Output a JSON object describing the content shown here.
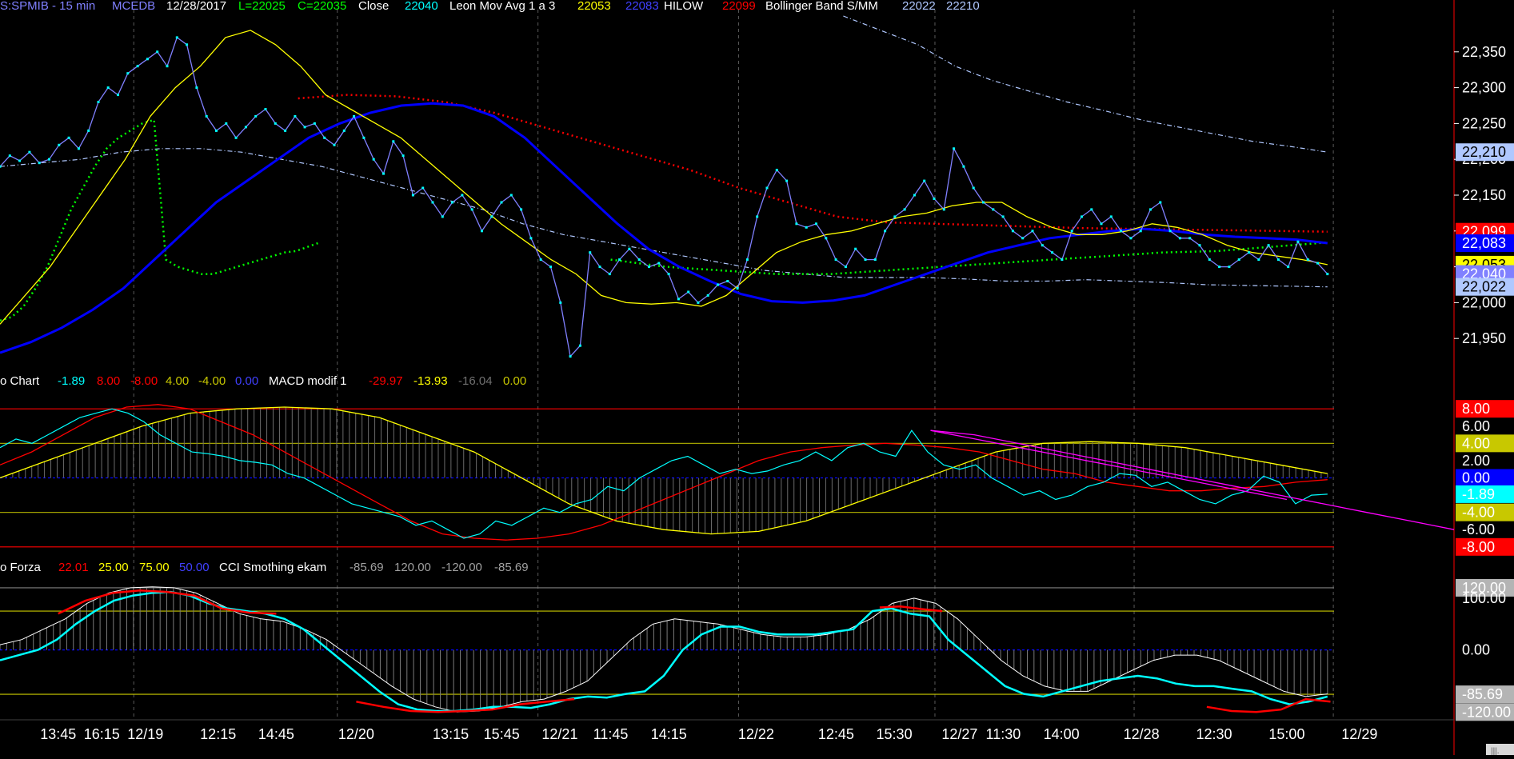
{
  "colors": {
    "background": "#000000",
    "axis_divider": "#ff0000",
    "price_close": "#8080ff",
    "price_points": "#00ffff",
    "leon_avg": "#ffff00",
    "hilow_blue": "#0000ff",
    "hilow_red": "#ff0000",
    "bollinger": "#b0c8ff",
    "green_dots": "#00ff00",
    "macd_cyan": "#00ffff",
    "macd_red": "#ff0000",
    "macd_yellow": "#ffff00",
    "magenta_trend": "#ff00ff",
    "cci_cyan": "#00ffff",
    "cci_red": "#ff0000",
    "cci_white": "#ffffff"
  },
  "header_price": {
    "symbol": "S:SPMIB - 15 min",
    "source": "MCEDB",
    "date": "12/28/2017",
    "low": "L=22025",
    "close_eq": "C=22035",
    "close_label": "Close",
    "close_value": "22040",
    "leon_label": "Leon Mov Avg 1 a 3",
    "leon_value": "22053",
    "hilow_blue_value": "22083",
    "hilow_label": "HILOW",
    "hilow_red_value": "22099",
    "bollinger_label": "Bollinger Band S/MM",
    "bollinger_low": "22022",
    "bollinger_high": "22210"
  },
  "header_macd": {
    "chart_label": "o Chart",
    "v1": "-1.89",
    "v2": "8.00",
    "v3": "-8.00",
    "v4": "4.00",
    "v5": "-4.00",
    "v6": "0.00",
    "macd_label": "MACD modif 1",
    "v7": "-29.97",
    "v8": "-13.93",
    "v9": "-16.04",
    "v10": "0.00"
  },
  "header_cci": {
    "forza_label": "o Forza",
    "v1": "22.01",
    "v2": "25.00",
    "v3": "75.00",
    "v4": "50.00",
    "cci_label": "CCI Smothing ekam",
    "v5": "-85.69",
    "v6": "120.00",
    "v7": "-120.00",
    "v8": "-85.69"
  },
  "axis_price": [
    "22,350",
    "22,300",
    "22,250",
    "22,200",
    "22,150",
    "22,100",
    "22,050",
    "22,000",
    "21,950"
  ],
  "axis_price_values": [
    22350,
    22300,
    22250,
    22200,
    22150,
    22100,
    22050,
    22000,
    21950
  ],
  "badges_price": [
    {
      "text": "22,210",
      "value": 22210,
      "bg": "#b0c8ff",
      "fg": "#000000"
    },
    {
      "text": "22,099",
      "value": 22099,
      "bg": "#ff0000",
      "fg": "#ffffff"
    },
    {
      "text": "22,083",
      "value": 22083,
      "bg": "#0000ff",
      "fg": "#ffffff"
    },
    {
      "text": "22,053",
      "value": 22053,
      "bg": "#ffff00",
      "fg": "#000000"
    },
    {
      "text": "22,040",
      "value": 22040,
      "bg": "#8080ff",
      "fg": "#ffffff"
    },
    {
      "text": "22,022",
      "value": 22022,
      "bg": "#b0c8ff",
      "fg": "#000000"
    }
  ],
  "axis_macd": [
    {
      "text": "8.00",
      "value": 8,
      "badge": "#ff0000",
      "fg": "#ffffff"
    },
    {
      "text": "6.00",
      "value": 6,
      "badge": "",
      "fg": "#ffffff"
    },
    {
      "text": "4.00",
      "value": 4,
      "badge": "#c8c800",
      "fg": "#000000"
    },
    {
      "text": "2.00",
      "value": 2,
      "badge": "",
      "fg": "#ffffff"
    },
    {
      "text": "0.00",
      "value": 0,
      "badge": "#0000ff",
      "fg": "#ffffff"
    },
    {
      "text": "-1.89",
      "value": -1.89,
      "badge": "#00ffff",
      "fg": "#000000"
    },
    {
      "text": "-4.00",
      "value": -4,
      "badge": "#c8c800",
      "fg": "#000000"
    },
    {
      "text": "-6.00",
      "value": -6,
      "badge": "",
      "fg": "#ffffff"
    },
    {
      "text": "-8.00",
      "value": -8,
      "badge": "#ff0000",
      "fg": "#ffffff"
    }
  ],
  "axis_cci": [
    {
      "text": "120.00",
      "value": 120,
      "badge": "#b4b4b4",
      "fg": "#000000"
    },
    {
      "text": "100.00",
      "value": 100,
      "badge": "",
      "fg": "#ffffff"
    },
    {
      "text": "0.00",
      "value": 0,
      "badge": "",
      "fg": "#ffffff"
    },
    {
      "text": "-85.69",
      "value": -85.69,
      "badge": "#b4b4b4",
      "fg": "#000000"
    },
    {
      "text": "-120.00",
      "value": -120,
      "badge": "#b4b4b4",
      "fg": "#000000"
    }
  ],
  "time_labels": [
    {
      "text": "13:45",
      "slot": 0.04
    },
    {
      "text": "16:15",
      "slot": 0.07
    },
    {
      "text": "12/19",
      "slot": 0.1
    },
    {
      "text": "12:15",
      "slot": 0.15
    },
    {
      "text": "14:45",
      "slot": 0.19
    },
    {
      "text": "12/20",
      "slot": 0.245
    },
    {
      "text": "13:15",
      "slot": 0.31
    },
    {
      "text": "15:45",
      "slot": 0.345
    },
    {
      "text": "12/21",
      "slot": 0.385
    },
    {
      "text": "11:45",
      "slot": 0.42
    },
    {
      "text": "14:15",
      "slot": 0.46
    },
    {
      "text": "12/22",
      "slot": 0.52
    },
    {
      "text": "12:45",
      "slot": 0.575
    },
    {
      "text": "15:30",
      "slot": 0.615
    },
    {
      "text": "12/27",
      "slot": 0.66
    },
    {
      "text": "11:30",
      "slot": 0.69
    },
    {
      "text": "14:00",
      "slot": 0.73
    },
    {
      "text": "12/28",
      "slot": 0.785
    },
    {
      "text": "12:30",
      "slot": 0.835
    },
    {
      "text": "15:00",
      "slot": 0.885
    },
    {
      "text": "12/29",
      "slot": 0.935
    }
  ],
  "day_separators": [
    0.092,
    0.232,
    0.37,
    0.508,
    0.643,
    0.78,
    0.917
  ],
  "scroll_label": "|||.",
  "chart_data": [
    {
      "type": "line",
      "series": [
        {
          "values": [
            22190,
            22205,
            22198,
            22210,
            22195,
            22200,
            22220,
            22230,
            22215,
            22240,
            22280,
            22300,
            22290,
            22320,
            22330,
            22340,
            22350,
            22330,
            22370,
            22360,
            22300,
            22260,
            22240,
            22250,
            22230,
            22245,
            22260,
            22270,
            22250,
            22240,
            22260,
            22245,
            22250,
            22230,
            22220,
            22240,
            22260,
            22230,
            22200,
            22180,
            22225,
            22205,
            22150,
            22160,
            22140,
            22120,
            22140,
            22150,
            22130,
            22100,
            22120,
            22140,
            22150,
            22130,
            22090,
            22060,
            22050,
            22000,
            21925,
            21940,
            22070,
            22050,
            22040,
            22060,
            22075,
            22060,
            22050,
            22055,
            22040,
            22005,
            22015,
            22000,
            22010,
            22025,
            22030,
            22020,
            22060,
            22120,
            22160,
            22185,
            22170,
            22110,
            22105,
            22110,
            22090,
            22060,
            22050,
            22075,
            22060,
            22060,
            22100,
            22120,
            22130,
            22150,
            22170,
            22145,
            22130,
            22215,
            22190,
            22160,
            22140,
            22130,
            22120,
            22100,
            22090,
            22100,
            22080,
            22070,
            22060,
            22100,
            22120,
            22130,
            22110,
            22120,
            22100,
            22090,
            22100,
            22130,
            22140,
            22100,
            22090,
            22090,
            22080,
            22060,
            22050,
            22050,
            22060,
            22070,
            22060,
            22080,
            22060,
            22050,
            22085,
            22060,
            22055,
            22040
          ]
        },
        {
          "values": [
            21970,
            22010,
            22050,
            22100,
            22150,
            22200,
            22260,
            22300,
            22330,
            22370,
            22380,
            22360,
            22330,
            22290,
            22270,
            22250,
            22230,
            22200,
            22170,
            22140,
            22110,
            22085,
            22060,
            22040,
            22010,
            22000,
            21998,
            22000,
            21995,
            22010,
            22040,
            22070,
            22085,
            22095,
            22100,
            22110,
            22120,
            22125,
            22135,
            22140,
            22140,
            22120,
            22105,
            22095,
            22095,
            22100,
            22110,
            22105,
            22095,
            22080,
            22070,
            22065,
            22060,
            22053
          ]
        },
        {
          "values": [
            21930,
            21945,
            21965,
            21990,
            22020,
            22060,
            22100,
            22140,
            22170,
            22200,
            22230,
            22250,
            22265,
            22275,
            22278,
            22275,
            22260,
            22230,
            22190,
            22150,
            22110,
            22075,
            22050,
            22030,
            22012,
            22002,
            22000,
            22003,
            22010,
            22025,
            22040,
            22055,
            22070,
            22080,
            22090,
            22095,
            22100,
            22103,
            22100,
            22095,
            22092,
            22090,
            22088,
            22083
          ]
        },
        {
          "values": [
            22285,
            22290,
            22288,
            22280,
            22265,
            22245,
            22225,
            22205,
            22185,
            22160,
            22140,
            22120,
            22112,
            22110,
            22108,
            22106,
            22104,
            22103,
            22102,
            22101,
            22100,
            22099
          ]
        },
        {
          "values": [
            21975,
            21980,
            21995,
            22020,
            22050,
            22090,
            22130,
            22160,
            22190,
            22215,
            22230,
            22240,
            22250,
            22255,
            22060,
            22050,
            22045,
            22040,
            22040,
            22045,
            22050,
            22055,
            22060,
            22065,
            22070,
            22072,
            22078,
            22084
          ]
        },
        {
          "values": [
            22190,
            22195,
            22200,
            22210,
            22215,
            22215,
            22210,
            22200,
            22190,
            22175,
            22160,
            22145,
            22130,
            22110,
            22095,
            22085,
            22075,
            22065,
            22055,
            22045,
            22040,
            22035,
            22035,
            22035,
            22033,
            22030,
            22030,
            22032,
            22030,
            22028,
            22025,
            22024,
            22023,
            22022
          ]
        },
        {
          "values": [
            22400,
            22380,
            22360,
            22330,
            22310,
            22295,
            22280,
            22268,
            22255,
            22245,
            22235,
            22225,
            22218,
            22210
          ]
        }
      ]
    },
    {
      "type": "line",
      "series": [
        {
          "values": [
            3.5,
            4.5,
            4,
            5,
            6,
            7,
            7.5,
            8,
            7.5,
            6.5,
            5,
            4,
            3,
            2.8,
            2.5,
            2,
            1.8,
            1.5,
            0.5,
            0,
            -1,
            -2,
            -3,
            -3.5,
            -4,
            -4.5,
            -5.5,
            -5,
            -6,
            -7,
            -6.5,
            -5,
            -5.5,
            -4.5,
            -3.5,
            -4,
            -3,
            -2.5,
            -1,
            -1.5,
            0,
            1,
            2,
            2.5,
            1.5,
            0.5,
            1,
            0.5,
            0.8,
            1.5,
            2,
            3,
            2,
            3.5,
            4,
            3,
            2.5,
            5.5,
            3,
            1.5,
            1,
            1.5,
            0,
            -1,
            -2,
            -1.5,
            -2.5,
            -2,
            -1,
            -0.5,
            0.5,
            0.3,
            -1,
            -0.5,
            -1.5,
            -2.5,
            -3,
            -2,
            -1.5,
            0.2,
            -0.5,
            -3,
            -2,
            -1.89
          ]
        },
        {
          "values": [
            1.5,
            3,
            5,
            7,
            8.2,
            8.5,
            8,
            6.5,
            5,
            3,
            1,
            -1,
            -3,
            -5,
            -6.5,
            -7,
            -7.2,
            -7,
            -6.5,
            -5.5,
            -4,
            -2.5,
            -1,
            0.5,
            2,
            3,
            3.5,
            3.8,
            4,
            3.8,
            3.5,
            3,
            2,
            1,
            0.5,
            -0.5,
            -1,
            -1.5,
            -1.5,
            -1.2,
            -1,
            -0.5,
            -0.2
          ]
        },
        {
          "values": [
            0,
            2,
            4,
            6,
            7.5,
            8,
            8.2,
            8,
            7,
            5,
            3,
            0,
            -3,
            -5,
            -6,
            -6.5,
            -6.2,
            -5,
            -3,
            -1,
            1,
            3,
            4,
            4.2,
            4,
            3.5,
            2.5,
            1.5,
            0.5
          ]
        },
        {
          "values": [
            5.5,
            5,
            4,
            3,
            2,
            1,
            0,
            -1,
            -2,
            -3,
            -4,
            -5,
            -6
          ]
        },
        {
          "values": [
            5.5,
            4.5,
            3.5,
            2.5,
            1.5,
            0.5,
            -0.5,
            -1.5,
            -2.5
          ]
        }
      ]
    },
    {
      "type": "line",
      "series": [
        {
          "values": [
            -20,
            -10,
            0,
            20,
            50,
            75,
            95,
            105,
            110,
            112,
            105,
            90,
            80,
            75,
            70,
            60,
            40,
            10,
            -20,
            -50,
            -80,
            -105,
            -115,
            -118,
            -118,
            -115,
            -110,
            -110,
            -112,
            -105,
            -95,
            -90,
            -92,
            -85,
            -80,
            -50,
            0,
            30,
            45,
            45,
            35,
            30,
            30,
            30,
            35,
            40,
            75,
            80,
            70,
            65,
            20,
            -10,
            -40,
            -70,
            -85,
            -90,
            -80,
            -70,
            -60,
            -55,
            -50,
            -55,
            -65,
            -70,
            -70,
            -75,
            -80,
            -95,
            -105,
            -100,
            -90
          ]
        },
        {
          "values": [
            70,
            95,
            110,
            115,
            112,
            105,
            80,
            72,
            70,
            -100,
            -110,
            -118,
            -120,
            -118,
            -115,
            -105,
            -100,
            -95,
            82,
            84,
            79,
            75,
            -110,
            -118,
            -120,
            -115,
            -95,
            -100
          ]
        },
        {
          "values": [
            10,
            20,
            40,
            60,
            90,
            110,
            120,
            122,
            120,
            110,
            90,
            70,
            60,
            55,
            40,
            20,
            -10,
            -40,
            -70,
            -95,
            -110,
            -120,
            -118,
            -110,
            -100,
            -95,
            -80,
            -60,
            -20,
            20,
            50,
            60,
            55,
            50,
            40,
            30,
            25,
            25,
            30,
            40,
            60,
            90,
            100,
            90,
            60,
            20,
            -20,
            -50,
            -70,
            -80,
            -80,
            -60,
            -40,
            -20,
            -10,
            -10,
            -20,
            -40,
            -60,
            -80,
            -90,
            -85
          ]
        }
      ]
    }
  ]
}
